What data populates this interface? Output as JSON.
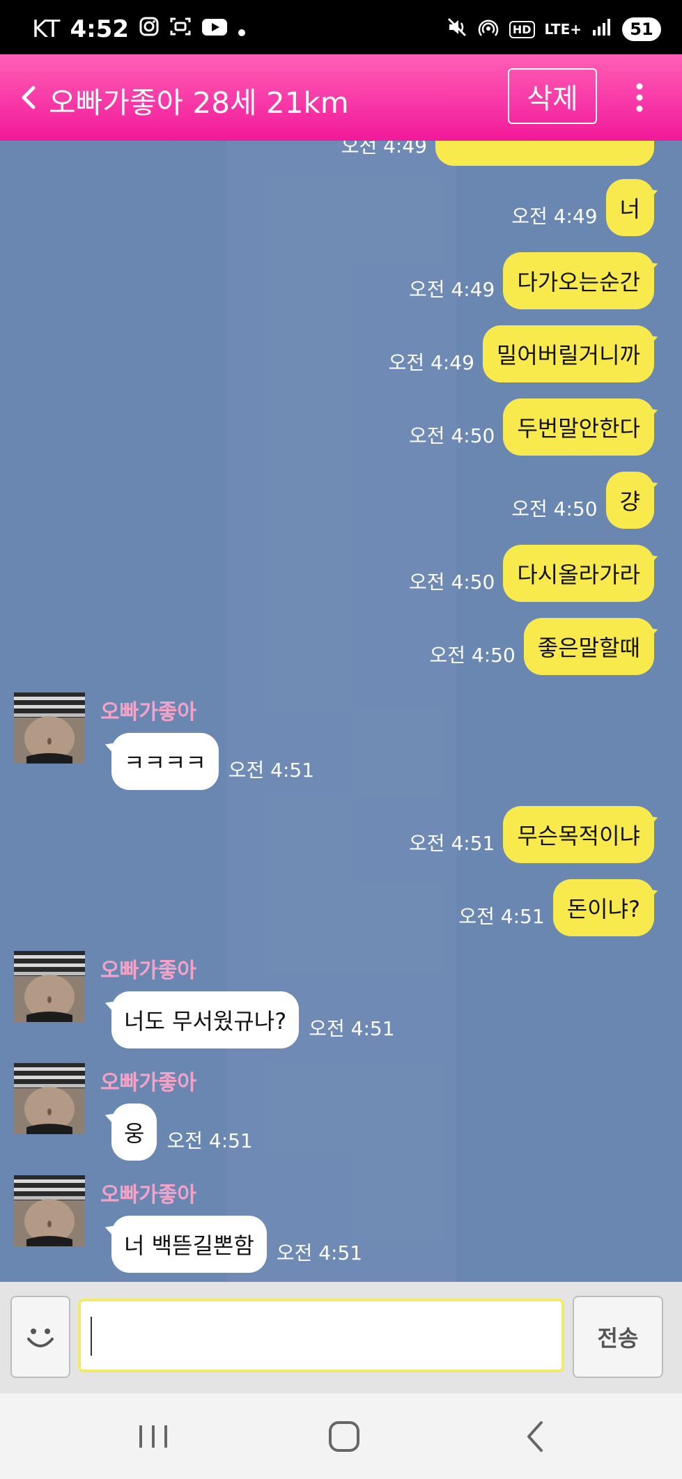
{
  "status_bar": {
    "carrier": "KT",
    "time": "4:52",
    "network": "LTE+",
    "battery": "51",
    "hd_label": "HD"
  },
  "header": {
    "title": "오빠가좋아 28세 21km",
    "delete_label": "삭제"
  },
  "chat": {
    "partial_message_time": "오전 4:49",
    "messages": [
      {
        "dir": "out",
        "text": "너",
        "time": "오전 4:49"
      },
      {
        "dir": "out",
        "text": "다가오는순간",
        "time": "오전 4:49"
      },
      {
        "dir": "out",
        "text": "밀어버릴거니까",
        "time": "오전 4:49"
      },
      {
        "dir": "out",
        "text": "두번말안한다",
        "time": "오전 4:50"
      },
      {
        "dir": "out",
        "text": "걍",
        "time": "오전 4:50"
      },
      {
        "dir": "out",
        "text": "다시올라가라",
        "time": "오전 4:50"
      },
      {
        "dir": "out",
        "text": "좋은말할때",
        "time": "오전 4:50"
      },
      {
        "dir": "in",
        "sender": "오빠가좋아",
        "text": "ㅋㅋㅋㅋ",
        "time": "오전 4:51"
      },
      {
        "dir": "out",
        "text": "무슨목적이냐",
        "time": "오전 4:51"
      },
      {
        "dir": "out",
        "text": "돈이냐?",
        "time": "오전 4:51"
      },
      {
        "dir": "in",
        "sender": "오빠가좋아",
        "text": "너도 무서웠규나?",
        "time": "오전 4:51"
      },
      {
        "dir": "in",
        "sender": "오빠가좋아",
        "text": "웅",
        "time": "오전 4:51"
      },
      {
        "dir": "in",
        "sender": "오빠가좋아",
        "text": "너 백뜯길뽄함",
        "time": "오전 4:51"
      }
    ]
  },
  "input": {
    "value": "",
    "placeholder": "",
    "send_label": "전송"
  },
  "colors": {
    "header_pink": "#f2199a",
    "chat_bg": "#6a87b2",
    "outgoing_bubble": "#f8e94c",
    "incoming_bubble": "#ffffff",
    "sender_name": "#f4a3c8"
  }
}
